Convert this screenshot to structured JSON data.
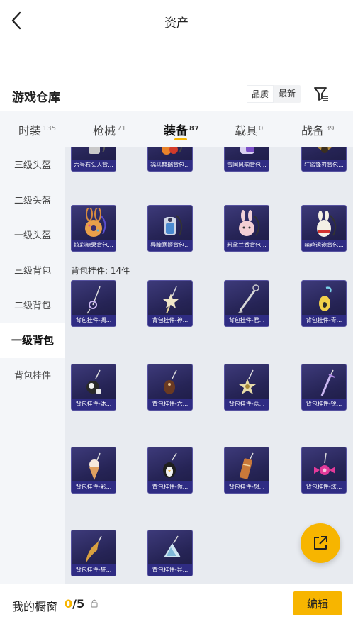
{
  "header": {
    "title": "资产"
  },
  "warehouse": {
    "title": "游戏仓库",
    "sort_options": [
      {
        "label": "品质",
        "active": true
      },
      {
        "label": "最新",
        "active": false
      }
    ]
  },
  "tabs": [
    {
      "label": "时装",
      "count": "135",
      "active": false
    },
    {
      "label": "枪械",
      "count": "71",
      "active": false
    },
    {
      "label": "装备",
      "count": "87",
      "active": true
    },
    {
      "label": "载具",
      "count": "0",
      "active": false
    },
    {
      "label": "战备",
      "count": "39",
      "active": false
    }
  ],
  "sidebar": {
    "items": [
      {
        "label": "三级头盔",
        "active": false
      },
      {
        "label": "二级头盔",
        "active": false
      },
      {
        "label": "一级头盔",
        "active": false
      },
      {
        "label": "三级背包",
        "active": false
      },
      {
        "label": "二级背包",
        "active": false
      },
      {
        "label": "一级背包",
        "active": true
      },
      {
        "label": "背包挂件",
        "active": false
      }
    ]
  },
  "content": {
    "top_row": [
      "六号石头人背...",
      "福马麒瑞背包...",
      "雪国风韵背包...",
      "狂鲨锋刃背包..."
    ],
    "backpacks": [
      "炫彩糖果背包...",
      "异瞳寒姬背包...",
      "粉黛兰香背包...",
      "萌鸡运途背包..."
    ],
    "charm_group_title": "背包挂件: 14件",
    "charms": [
      "背包挂件-凋...",
      "背包挂件-神...",
      "背包挂件-君...",
      "背包挂件-青...",
      "背包挂件-沐...",
      "背包挂件-六...",
      "背包挂件-蕊...",
      "背包挂件-锐...",
      "背包挂件-彩...",
      "背包挂件-你...",
      "背包挂件-想...",
      "背包挂件-炫...",
      "背包挂件-狂...",
      "背包挂件-异..."
    ]
  },
  "bottom": {
    "showcase_label": "我的橱窗",
    "showcase_current": "0",
    "showcase_total": "/5",
    "edit_label": "编辑"
  },
  "colors": {
    "accent": "#f7b500",
    "card_bg": "#262456",
    "card_label": "#2f2c83",
    "panel_bg": "#e8ebf0"
  }
}
